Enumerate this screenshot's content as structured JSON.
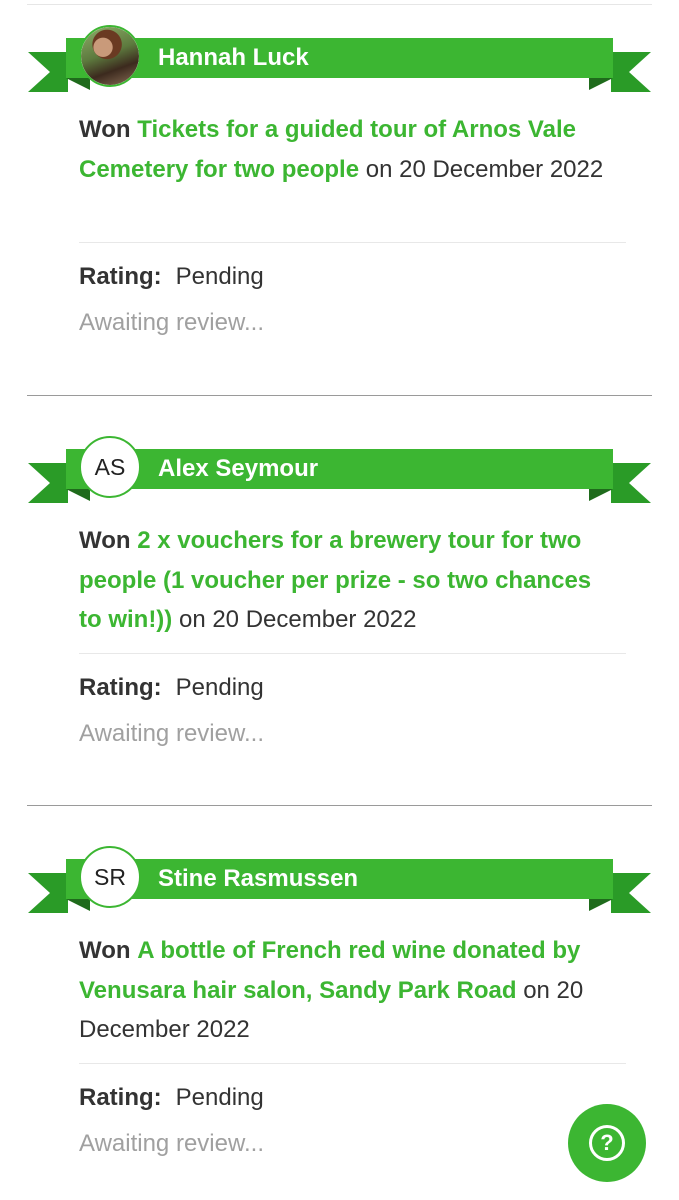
{
  "entries": [
    {
      "name": "Hannah Luck",
      "avatar_type": "photo",
      "initials": "",
      "won_word": "Won",
      "prize": "Tickets for a guided tour of Arnos Vale Cemetery for two people",
      "date_text": "on 20 December 2022",
      "rating_label": "Rating:",
      "rating_value": "Pending",
      "review_text": "Awaiting review..."
    },
    {
      "name": "Alex Seymour",
      "avatar_type": "initials",
      "initials": "AS",
      "won_word": "Won",
      "prize": "2 x vouchers for a brewery tour for two people (1 voucher per prize - so two chances to win!))",
      "date_text": "on 20 December 2022",
      "rating_label": "Rating:",
      "rating_value": "Pending",
      "review_text": "Awaiting review..."
    },
    {
      "name": "Stine Rasmussen",
      "avatar_type": "initials",
      "initials": "SR",
      "won_word": "Won",
      "prize": "A bottle of French red wine donated by Venusara hair salon, Sandy Park Road",
      "date_text": "on 20 December 2022",
      "rating_label": "Rating:",
      "rating_value": "Pending",
      "review_text": "Awaiting review..."
    }
  ],
  "help_button": {
    "icon": "question-mark-icon",
    "glyph": "?"
  },
  "colors": {
    "ribbon": "#3cb632",
    "link": "#3cb632",
    "ribbon_tail": "#2a9b27",
    "muted": "#a0a0a0"
  }
}
